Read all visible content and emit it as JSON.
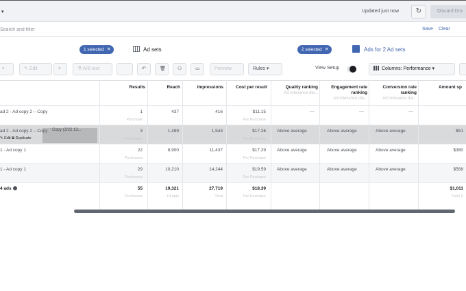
{
  "topbar": {
    "caret": "▾",
    "updated": "Updated just now",
    "refresh_icon": "refresh-icon",
    "discard_label": "Discard Dra"
  },
  "search": {
    "placeholder": "Search and filter",
    "save": "Save",
    "clear": "Clear"
  },
  "levels": {
    "adsets_selected": "1 selected",
    "adsets_tab": "Ad sets",
    "ads_selected": "2 selected",
    "ads_tab": "Ads for 2 Ad sets"
  },
  "toolbar": {
    "edit": "Edit",
    "ab_test": "A/B test",
    "preview": "Preview",
    "rules": "Rules",
    "view_setup": "View Setup",
    "columns": "Columns: Performance"
  },
  "headers": {
    "results": "Results",
    "reach": "Reach",
    "impressions": "Impressions",
    "cost_per_result": "Cost per result",
    "quality": "Quality ranking",
    "quality_sub": "Ad relevance dia...",
    "engagement": "Engagement rate ranking",
    "engagement_sub": "Ad relevance dia...",
    "conversion": "Conversion rate ranking",
    "conversion_sub": "Ad relevance dia...",
    "amount": "Amount sp"
  },
  "rows": [
    {
      "name": "ad 2 - Ad copy 2 – Copy",
      "results": "1",
      "results_sub": "Purchase",
      "reach": "437",
      "impressions": "416",
      "cost": "$11.15",
      "cost_sub": "Per Purchase",
      "quality": "—",
      "engagement": "—",
      "conversion": "—",
      "amount": ""
    },
    {
      "name": "ad 2 - Ad copy 2 – Copy",
      "ghost": "Copy (3/22 13...",
      "edit_line": "✎ Edit  ⧉ Duplicate",
      "results": "3",
      "results_sub": "Purchases",
      "reach": "1,489",
      "impressions": "1,543",
      "cost": "$17.26",
      "cost_sub": "Per Purchase",
      "quality": "Above average",
      "engagement": "Above average",
      "conversion": "Above average",
      "amount": "$51"
    },
    {
      "name": "1 - Ad copy 1",
      "results": "22",
      "results_sub": "Purchases",
      "reach": "8,900",
      "impressions": "11,437",
      "cost": "$17.29",
      "cost_sub": "Per Purchase",
      "quality": "Above average",
      "engagement": "Above average",
      "conversion": "Above average",
      "amount": "$380"
    },
    {
      "name": "1 - Ad copy 1",
      "results": "29",
      "results_sub": "Purchases",
      "reach": "10,210",
      "impressions": "14,244",
      "cost": "$19.59",
      "cost_sub": "Per Purchase",
      "quality": "Above average",
      "engagement": "Above average",
      "conversion": "Above average",
      "amount": "$568"
    }
  ],
  "totals": {
    "name": "4 ads",
    "results": "55",
    "results_sub": "Purchases",
    "reach": "19,321",
    "reach_sub": "People",
    "impressions": "27,719",
    "impressions_sub": "Total",
    "cost": "$18.39",
    "cost_sub": "Per Purchase",
    "amount": "$1,011",
    "amount_sub": "Total S"
  },
  "colors": {
    "accent": "#4267b2",
    "selected_row": "#d9dadc"
  }
}
